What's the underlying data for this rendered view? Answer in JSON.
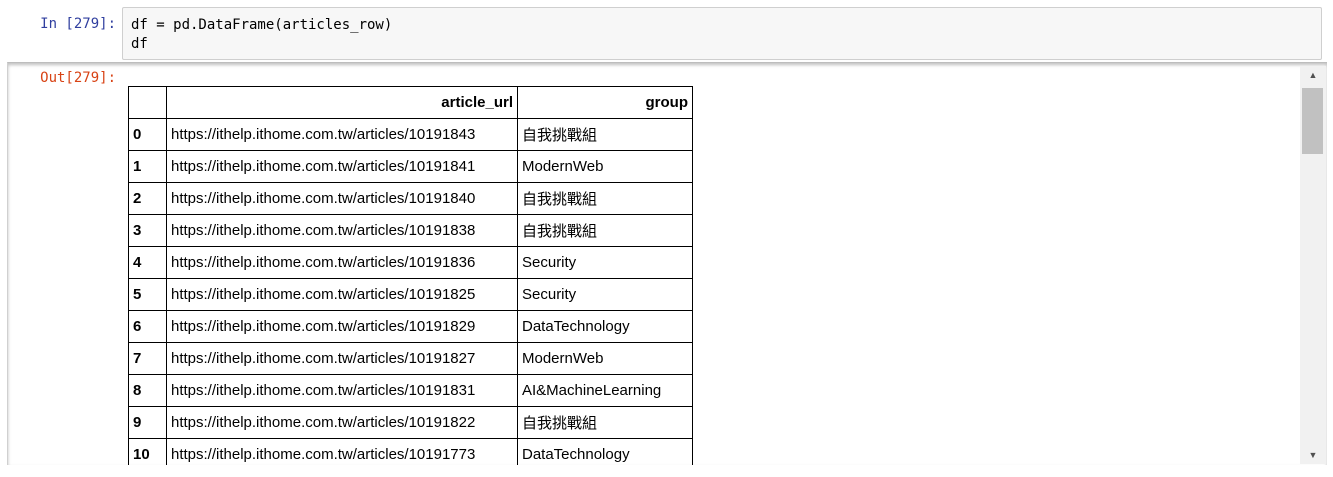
{
  "input_cell": {
    "prompt": "In [279]:",
    "code_lines": [
      "df = pd.DataFrame(articles_row)",
      "df"
    ]
  },
  "output_cell": {
    "prompt": "Out[279]:"
  },
  "table": {
    "columns": [
      "article_url",
      "group"
    ],
    "rows": [
      {
        "index": "0",
        "article_url": "https://ithelp.ithome.com.tw/articles/10191843",
        "group": "自我挑戰組"
      },
      {
        "index": "1",
        "article_url": "https://ithelp.ithome.com.tw/articles/10191841",
        "group": "ModernWeb"
      },
      {
        "index": "2",
        "article_url": "https://ithelp.ithome.com.tw/articles/10191840",
        "group": "自我挑戰組"
      },
      {
        "index": "3",
        "article_url": "https://ithelp.ithome.com.tw/articles/10191838",
        "group": "自我挑戰組"
      },
      {
        "index": "4",
        "article_url": "https://ithelp.ithome.com.tw/articles/10191836",
        "group": "Security"
      },
      {
        "index": "5",
        "article_url": "https://ithelp.ithome.com.tw/articles/10191825",
        "group": "Security"
      },
      {
        "index": "6",
        "article_url": "https://ithelp.ithome.com.tw/articles/10191829",
        "group": "DataTechnology"
      },
      {
        "index": "7",
        "article_url": "https://ithelp.ithome.com.tw/articles/10191827",
        "group": "ModernWeb"
      },
      {
        "index": "8",
        "article_url": "https://ithelp.ithome.com.tw/articles/10191831",
        "group": "AI&MachineLearning"
      },
      {
        "index": "9",
        "article_url": "https://ithelp.ithome.com.tw/articles/10191822",
        "group": "自我挑戰組"
      },
      {
        "index": "10",
        "article_url": "https://ithelp.ithome.com.tw/articles/10191773",
        "group": "DataTechnology"
      }
    ]
  },
  "scrollbar": {
    "up_icon": "triangle-up-icon",
    "down_icon": "triangle-down-icon"
  }
}
